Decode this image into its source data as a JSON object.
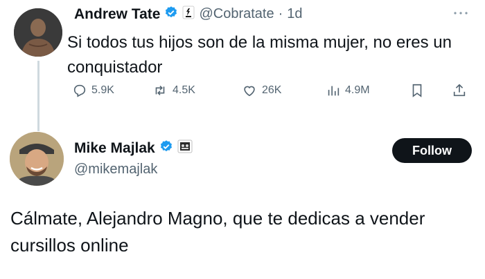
{
  "tweet1": {
    "display_name": "Andrew Tate",
    "handle": "@Cobratate",
    "separator": "·",
    "time": "1d",
    "text": "Si todos tus hijos son de la misma mujer, no eres un conquistador",
    "more_icon": "more-icon",
    "metrics": {
      "replies": "5.9K",
      "retweets": "4.5K",
      "likes": "26K",
      "views": "4.9M"
    }
  },
  "tweet2": {
    "display_name": "Mike Majlak",
    "handle": "@mikemajlak",
    "follow_label": "Follow",
    "text": "Cálmate, Alejandro Magno, que te dedicas a vender cursillos online"
  },
  "colors": {
    "verified": "#1d9bf0",
    "text_primary": "#0f1419",
    "text_secondary": "#536471",
    "follow_bg": "#0f1419"
  }
}
